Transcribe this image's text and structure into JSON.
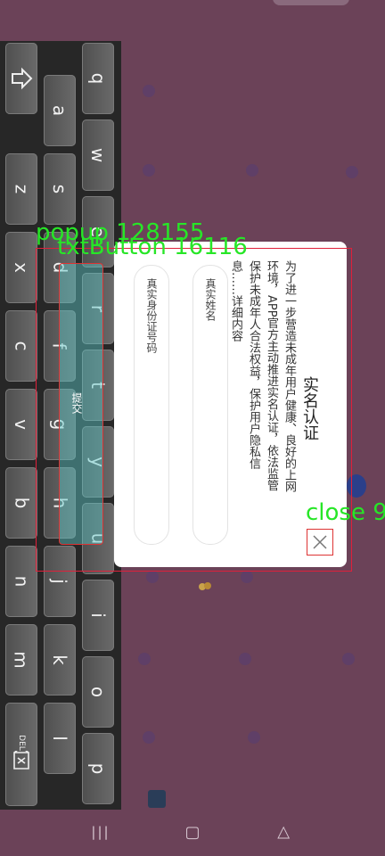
{
  "keyboard": {
    "rows": [
      [
        "q",
        "w",
        "e",
        "r",
        "t",
        "y",
        "u",
        "i",
        "o",
        "p"
      ],
      [
        "a",
        "s",
        "d",
        "f",
        "g",
        "h",
        "j",
        "k",
        "l"
      ],
      [
        "z",
        "x",
        "c",
        "v",
        "b",
        "n",
        "m"
      ]
    ],
    "del_label": "DEL"
  },
  "popup": {
    "title": "实名认证",
    "description": "为了进一步营造未成年用户健康、良好的上网环境，APP官方主动推进实名认证，依法监管保护未成年人合法权益，保护用户隐私信息……详细内容",
    "name_placeholder": "真实姓名",
    "id_placeholder": "真实身份证号码",
    "button_label": "提交"
  },
  "overlays": {
    "popup_label": "popup 128155",
    "txtbutton_label": "txtButton 16116",
    "close_label": "close 9"
  },
  "nav": {
    "recent": "|||",
    "home": "▢",
    "back": "◁"
  }
}
